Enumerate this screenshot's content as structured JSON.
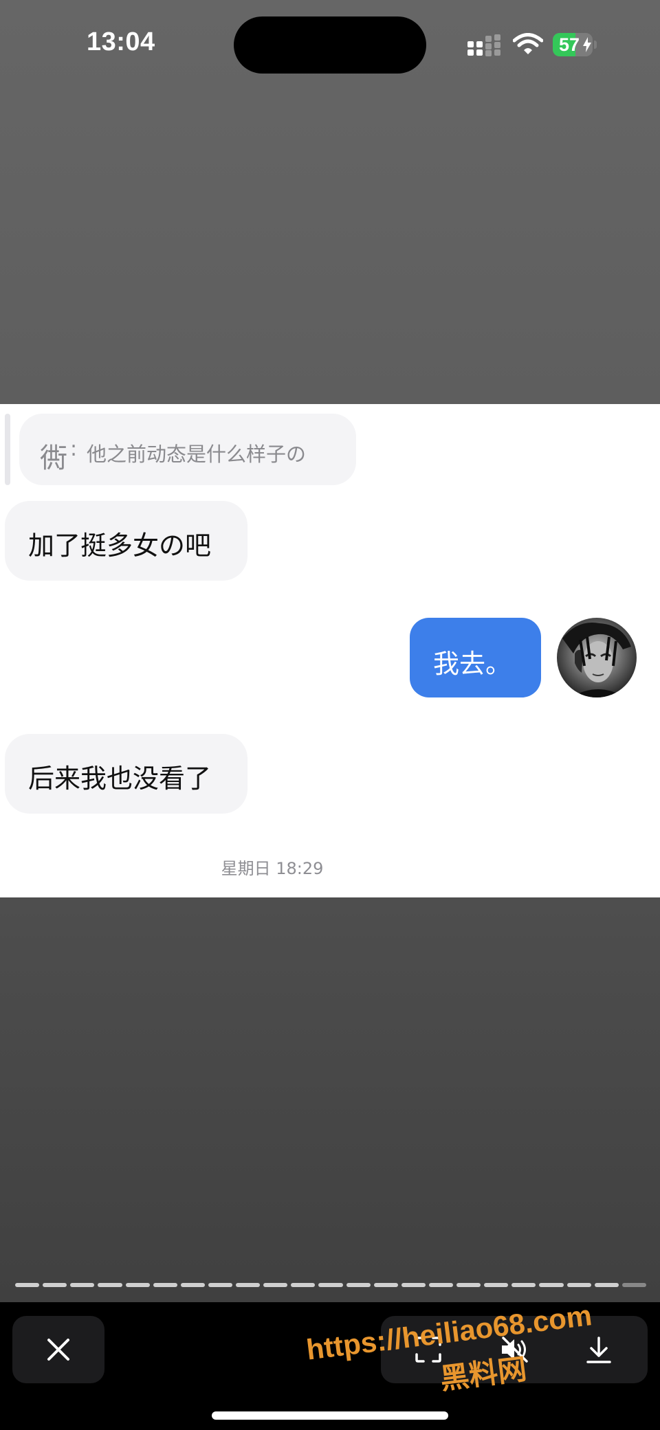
{
  "status_bar": {
    "time": "13:04",
    "battery_percent": "57",
    "battery_level": 0.57,
    "charging": true
  },
  "chat": {
    "quote": {
      "name": "衖",
      "colon": ":",
      "text": "他之前动态是什么样子の"
    },
    "messages": [
      {
        "direction": "incoming",
        "text": "加了挺多女の吧"
      },
      {
        "direction": "outgoing",
        "text": "我去。"
      },
      {
        "direction": "incoming",
        "text": "后来我也没看了"
      }
    ],
    "timestamp": "星期日 18:29"
  },
  "viewer": {
    "story_segments_total": 23,
    "story_segments_viewed": 22,
    "toolbar": {
      "close_icon": "close-icon",
      "action_icons": [
        "scan-icon",
        "mute-icon",
        "download-icon"
      ]
    }
  },
  "watermark": {
    "url": "https://heiliao68.com",
    "name": "黑料网"
  },
  "colors": {
    "accent_blue": "#3d7fea",
    "watermark_orange": "#e8962e",
    "battery_green": "#34c759"
  }
}
